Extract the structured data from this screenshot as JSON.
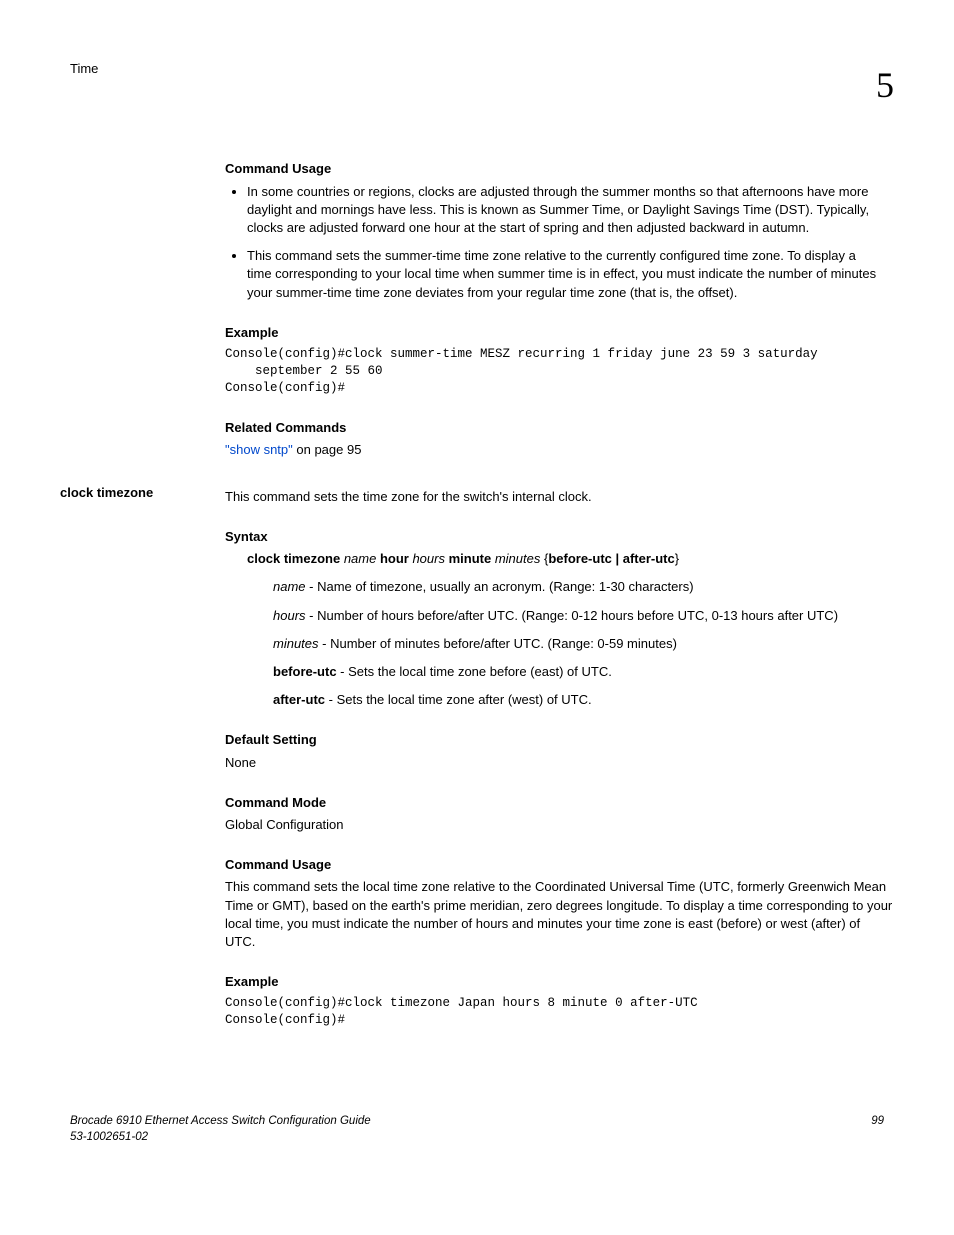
{
  "header": {
    "section": "Time",
    "chapter": "5"
  },
  "s1": {
    "heading": "Command Usage",
    "bullet1": "In some countries or regions, clocks are adjusted through the summer months so that afternoons have more daylight and mornings have less. This is known as Summer Time, or Daylight Savings Time (DST). Typically, clocks are adjusted forward one hour at the start of spring and then adjusted backward in autumn.",
    "bullet2": "This command sets the summer-time time zone relative to the currently configured time zone. To display a time corresponding to your local time when summer time is in effect, you must indicate the number of minutes your summer-time time zone deviates from your regular time zone (that is, the offset)."
  },
  "s2": {
    "heading": "Example",
    "code": "Console(config)#clock summer-time MESZ recurring 1 friday june 23 59 3 saturday\n    september 2 55 60\nConsole(config)#"
  },
  "s3": {
    "heading": "Related Commands",
    "link": "\"show sntp\"",
    "rest": " on page 95"
  },
  "cmd": {
    "name": "clock timezone",
    "desc": "This command sets the time zone for the switch's internal clock."
  },
  "syntax": {
    "heading": "Syntax",
    "p1a": "clock timezone",
    "p1b": " name ",
    "p1c": "hour",
    "p1d": " hours ",
    "p1e": "minute",
    "p1f": " minutes ",
    "p1g": "{",
    "p1h": "before-utc | after-utc",
    "p1i": "}",
    "name_i": "name",
    "name_t": " - Name of timezone, usually an acronym. (Range: 1-30 characters)",
    "hours_i": "hours",
    "hours_t": " - Number of hours before/after UTC. (Range: 0-12 hours before UTC, 0-13 hours after UTC)",
    "minutes_i": "minutes",
    "minutes_t": " - Number of minutes before/after UTC. (Range: 0-59 minutes)",
    "before_b": "before-utc",
    "before_t": " - Sets the local time zone before (east) of UTC.",
    "after_b": "after-utc",
    "after_t": " - Sets the local time zone after (west) of UTC."
  },
  "default": {
    "heading": "Default Setting",
    "text": "None"
  },
  "mode": {
    "heading": "Command Mode",
    "text": "Global Configuration"
  },
  "usage2": {
    "heading": "Command Usage",
    "text": "This command sets the local time zone relative to the Coordinated Universal Time (UTC, formerly Greenwich Mean Time or GMT), based on the earth's prime meridian, zero degrees longitude. To display a time corresponding to your local time, you must indicate the number of hours and minutes your time zone is east (before) or west (after) of UTC."
  },
  "example2": {
    "heading": "Example",
    "code": "Console(config)#clock timezone Japan hours 8 minute 0 after-UTC\nConsole(config)#"
  },
  "footer": {
    "left1": "Brocade 6910 Ethernet Access Switch Configuration Guide",
    "left2": "53-1002651-02",
    "right": "99"
  }
}
